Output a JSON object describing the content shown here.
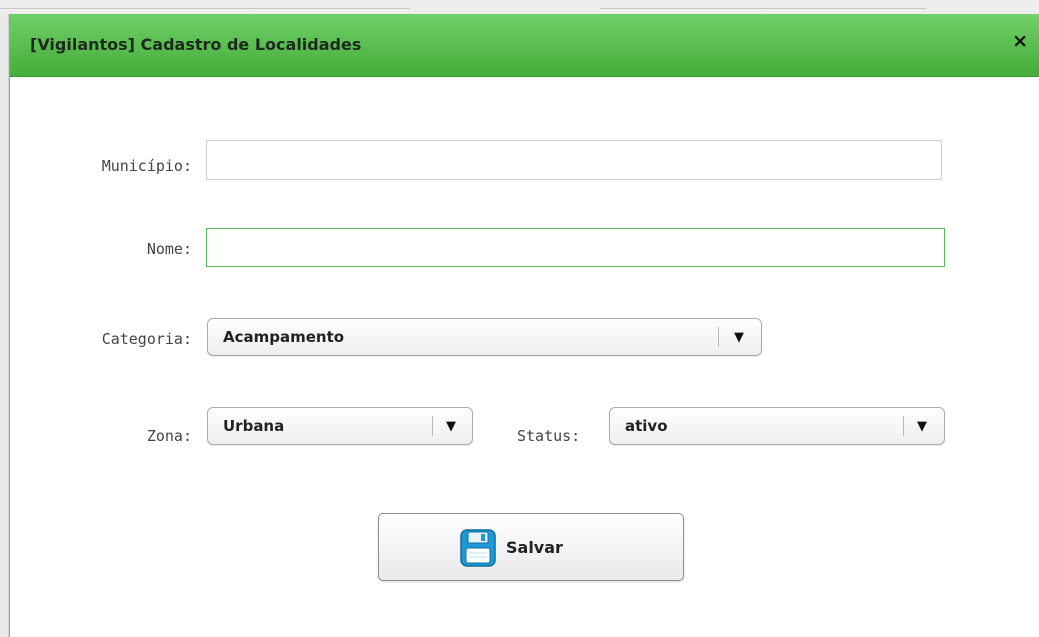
{
  "dialog": {
    "title": "[Vigilantos] Cadastro de Localidades",
    "close_label": "×"
  },
  "form": {
    "municipio": {
      "label": "Município:",
      "value": "",
      "placeholder": ""
    },
    "nome": {
      "label": "Nome:",
      "value": "",
      "placeholder": ""
    },
    "categoria": {
      "label": "Categoria:",
      "selected": "Acampamento"
    },
    "zona": {
      "label": "Zona:",
      "selected": "Urbana"
    },
    "status": {
      "label": "Status:",
      "selected": "ativo"
    },
    "dropdown_arrow": "▼"
  },
  "save_button": {
    "label": "Salvar",
    "icon": "floppy-disk-icon"
  },
  "colors": {
    "titlebar_green": "#5cc052",
    "focus_border": "#5cb85c",
    "icon_blue": "#1e9ad6"
  }
}
